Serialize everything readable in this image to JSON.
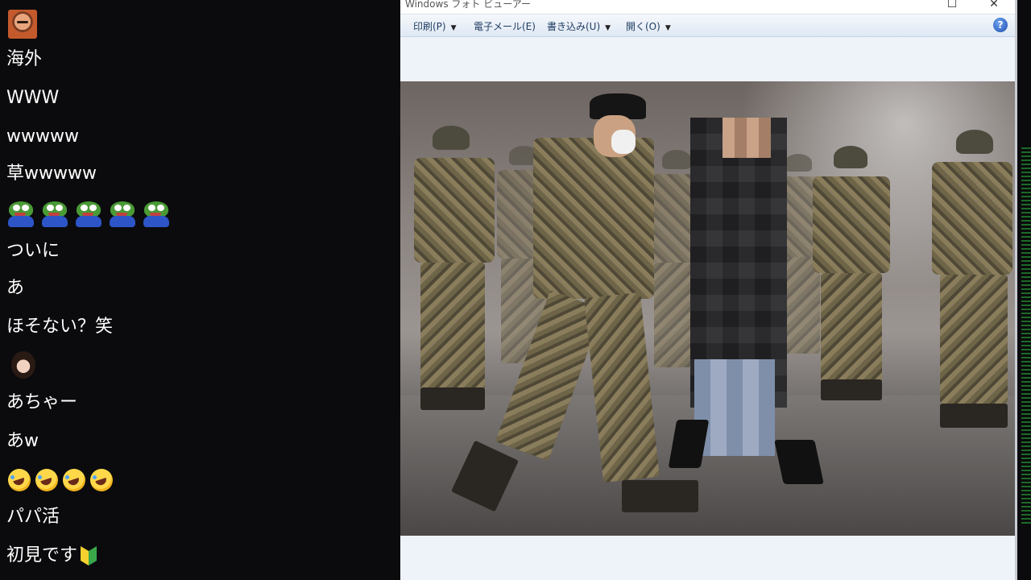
{
  "chat": {
    "messages": [
      {
        "type": "avatar",
        "icon": "man-avatar"
      },
      {
        "type": "text",
        "text": "海外"
      },
      {
        "type": "text",
        "text": "WWW"
      },
      {
        "type": "text",
        "text": "wwwww"
      },
      {
        "type": "text",
        "text": "草wwwww"
      },
      {
        "type": "emotes",
        "icon": "pepe-frog-emote",
        "count": 5
      },
      {
        "type": "text",
        "text": "ついに"
      },
      {
        "type": "text",
        "text": "あ"
      },
      {
        "type": "text",
        "text": "ほそない？笑"
      },
      {
        "type": "avatar",
        "icon": "woman-avatar"
      },
      {
        "type": "text",
        "text": "あちゃー"
      },
      {
        "type": "text",
        "text": "あw"
      },
      {
        "type": "emotes",
        "icon": "rofl-emoji",
        "count": 4
      },
      {
        "type": "text",
        "text": "パパ活"
      },
      {
        "type": "text",
        "text": "初見です",
        "suffix_icon": "beginner-mark-icon"
      }
    ]
  },
  "viewer": {
    "title": "Windows フォト ビューアー",
    "menu": [
      {
        "label": "印刷(P)",
        "has_dropdown": true
      },
      {
        "label": "電子メール(E)",
        "has_dropdown": false
      },
      {
        "label": "書き込み(U)",
        "has_dropdown": true
      },
      {
        "label": "開く(O)",
        "has_dropdown": true
      }
    ],
    "window_buttons": {
      "maximize": "☐",
      "close": "✕"
    },
    "help_label": "?",
    "background_color": "#eef2f9",
    "accent_color": "#1f4fb4"
  }
}
